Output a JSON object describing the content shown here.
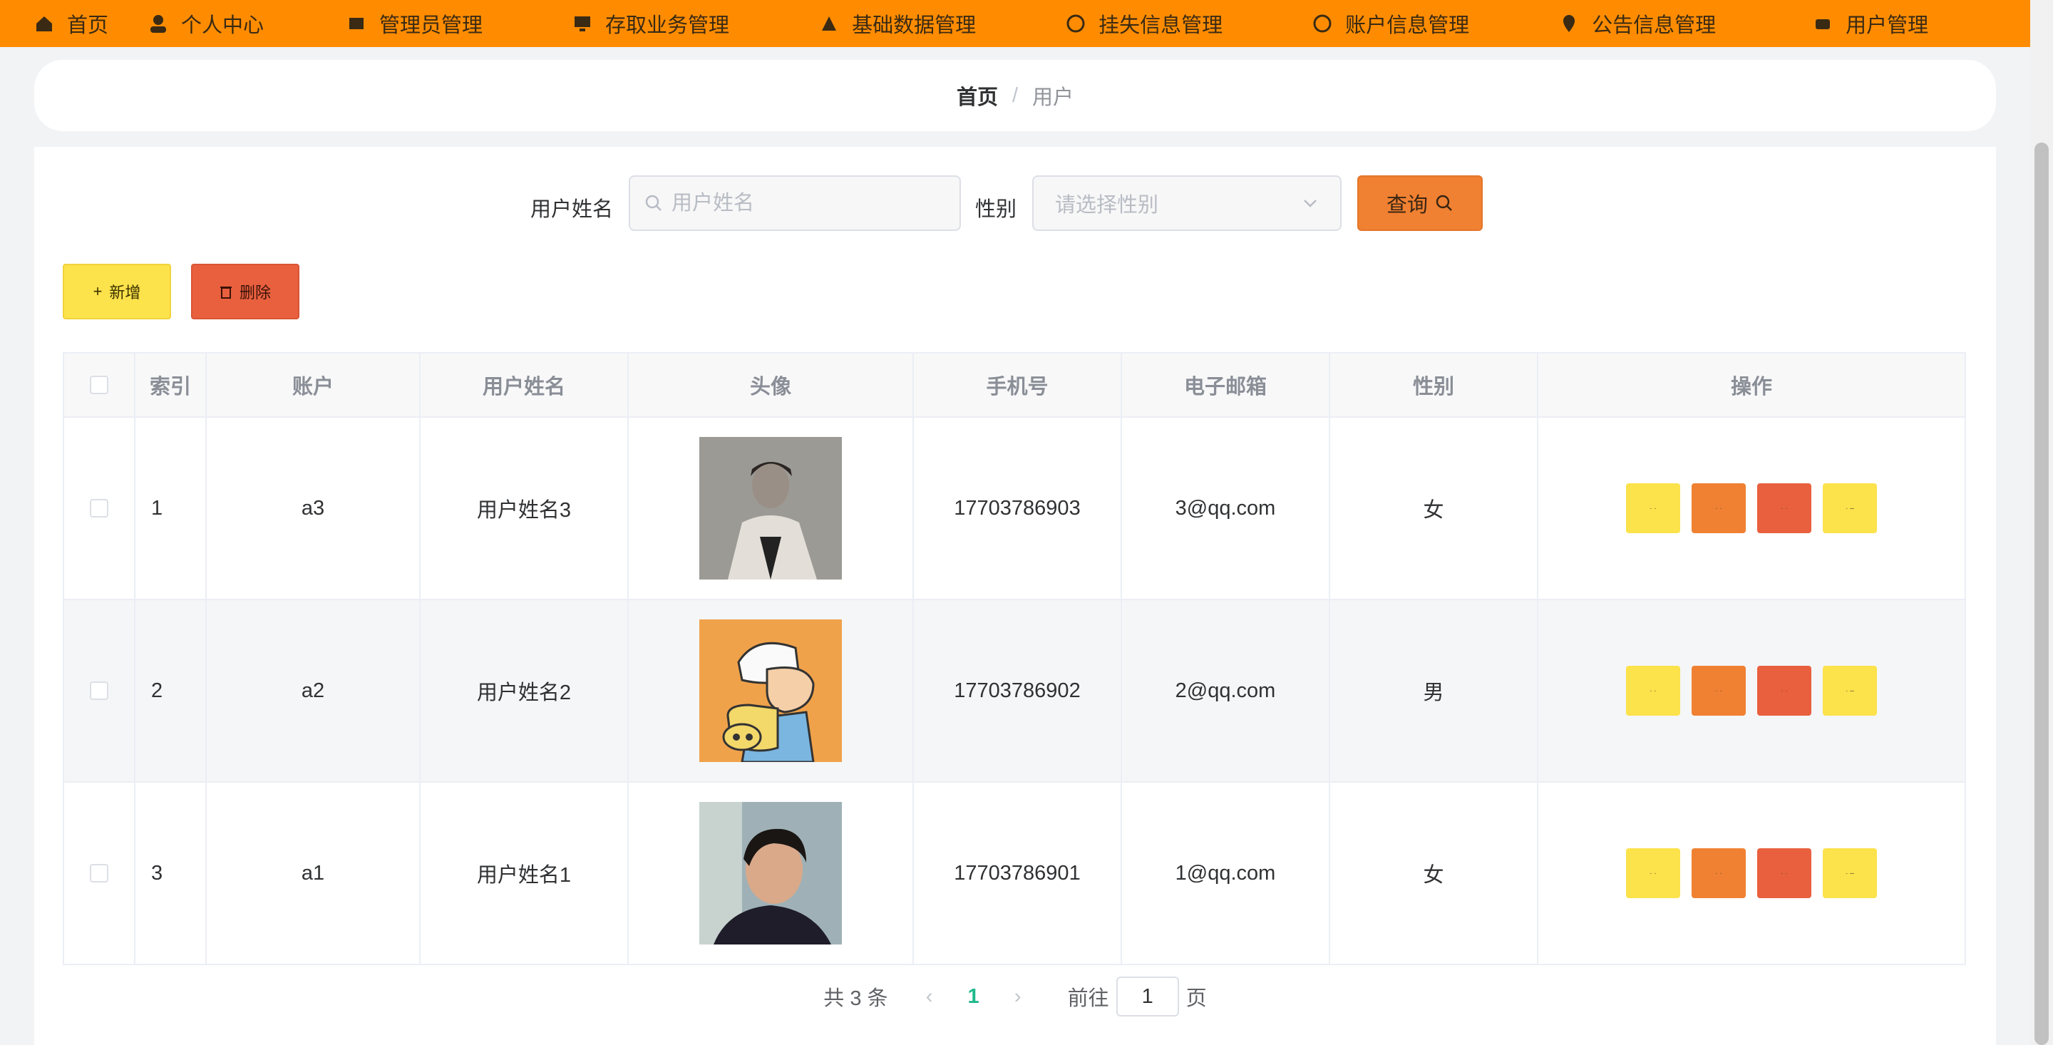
{
  "nav": {
    "items": [
      {
        "label": "首页"
      },
      {
        "label": "个人中心"
      },
      {
        "label": "管理员管理"
      },
      {
        "label": "存取业务管理"
      },
      {
        "label": "基础数据管理"
      },
      {
        "label": "挂失信息管理"
      },
      {
        "label": "账户信息管理"
      },
      {
        "label": "公告信息管理"
      },
      {
        "label": "用户管理"
      }
    ],
    "active": "用户管理",
    "accent": "#ff8c00"
  },
  "breadcrumb": {
    "home": "首页",
    "separator": "/",
    "current": "用户"
  },
  "search": {
    "name_label": "用户姓名",
    "name_placeholder": "用户姓名",
    "gender_label": "性别",
    "gender_placeholder": "请选择性别",
    "query_label": "查询"
  },
  "actions": {
    "add_label": "新增",
    "delete_label": "删除"
  },
  "table": {
    "headers": [
      "索引",
      "账户",
      "用户姓名",
      "头像",
      "手机号",
      "电子邮箱",
      "性别",
      "操作"
    ],
    "rows": [
      {
        "index": "1",
        "account": "a3",
        "name": "用户姓名3",
        "avatar": "man-in-coat-photo",
        "phone": "17703786903",
        "email": "3@qq.com",
        "gender": "女"
      },
      {
        "index": "2",
        "account": "a2",
        "name": "用户姓名2",
        "avatar": "cartoon-boy-avatar",
        "phone": "17703786902",
        "email": "2@qq.com",
        "gender": "男"
      },
      {
        "index": "3",
        "account": "a1",
        "name": "用户姓名1",
        "avatar": "young-man-selfie-photo",
        "phone": "17703786901",
        "email": "1@qq.com",
        "gender": "女"
      }
    ]
  },
  "pagination": {
    "total_text": "共 3 条",
    "current_page": "1",
    "goto_label": "前往",
    "goto_value": "1",
    "page_suffix": "页"
  }
}
